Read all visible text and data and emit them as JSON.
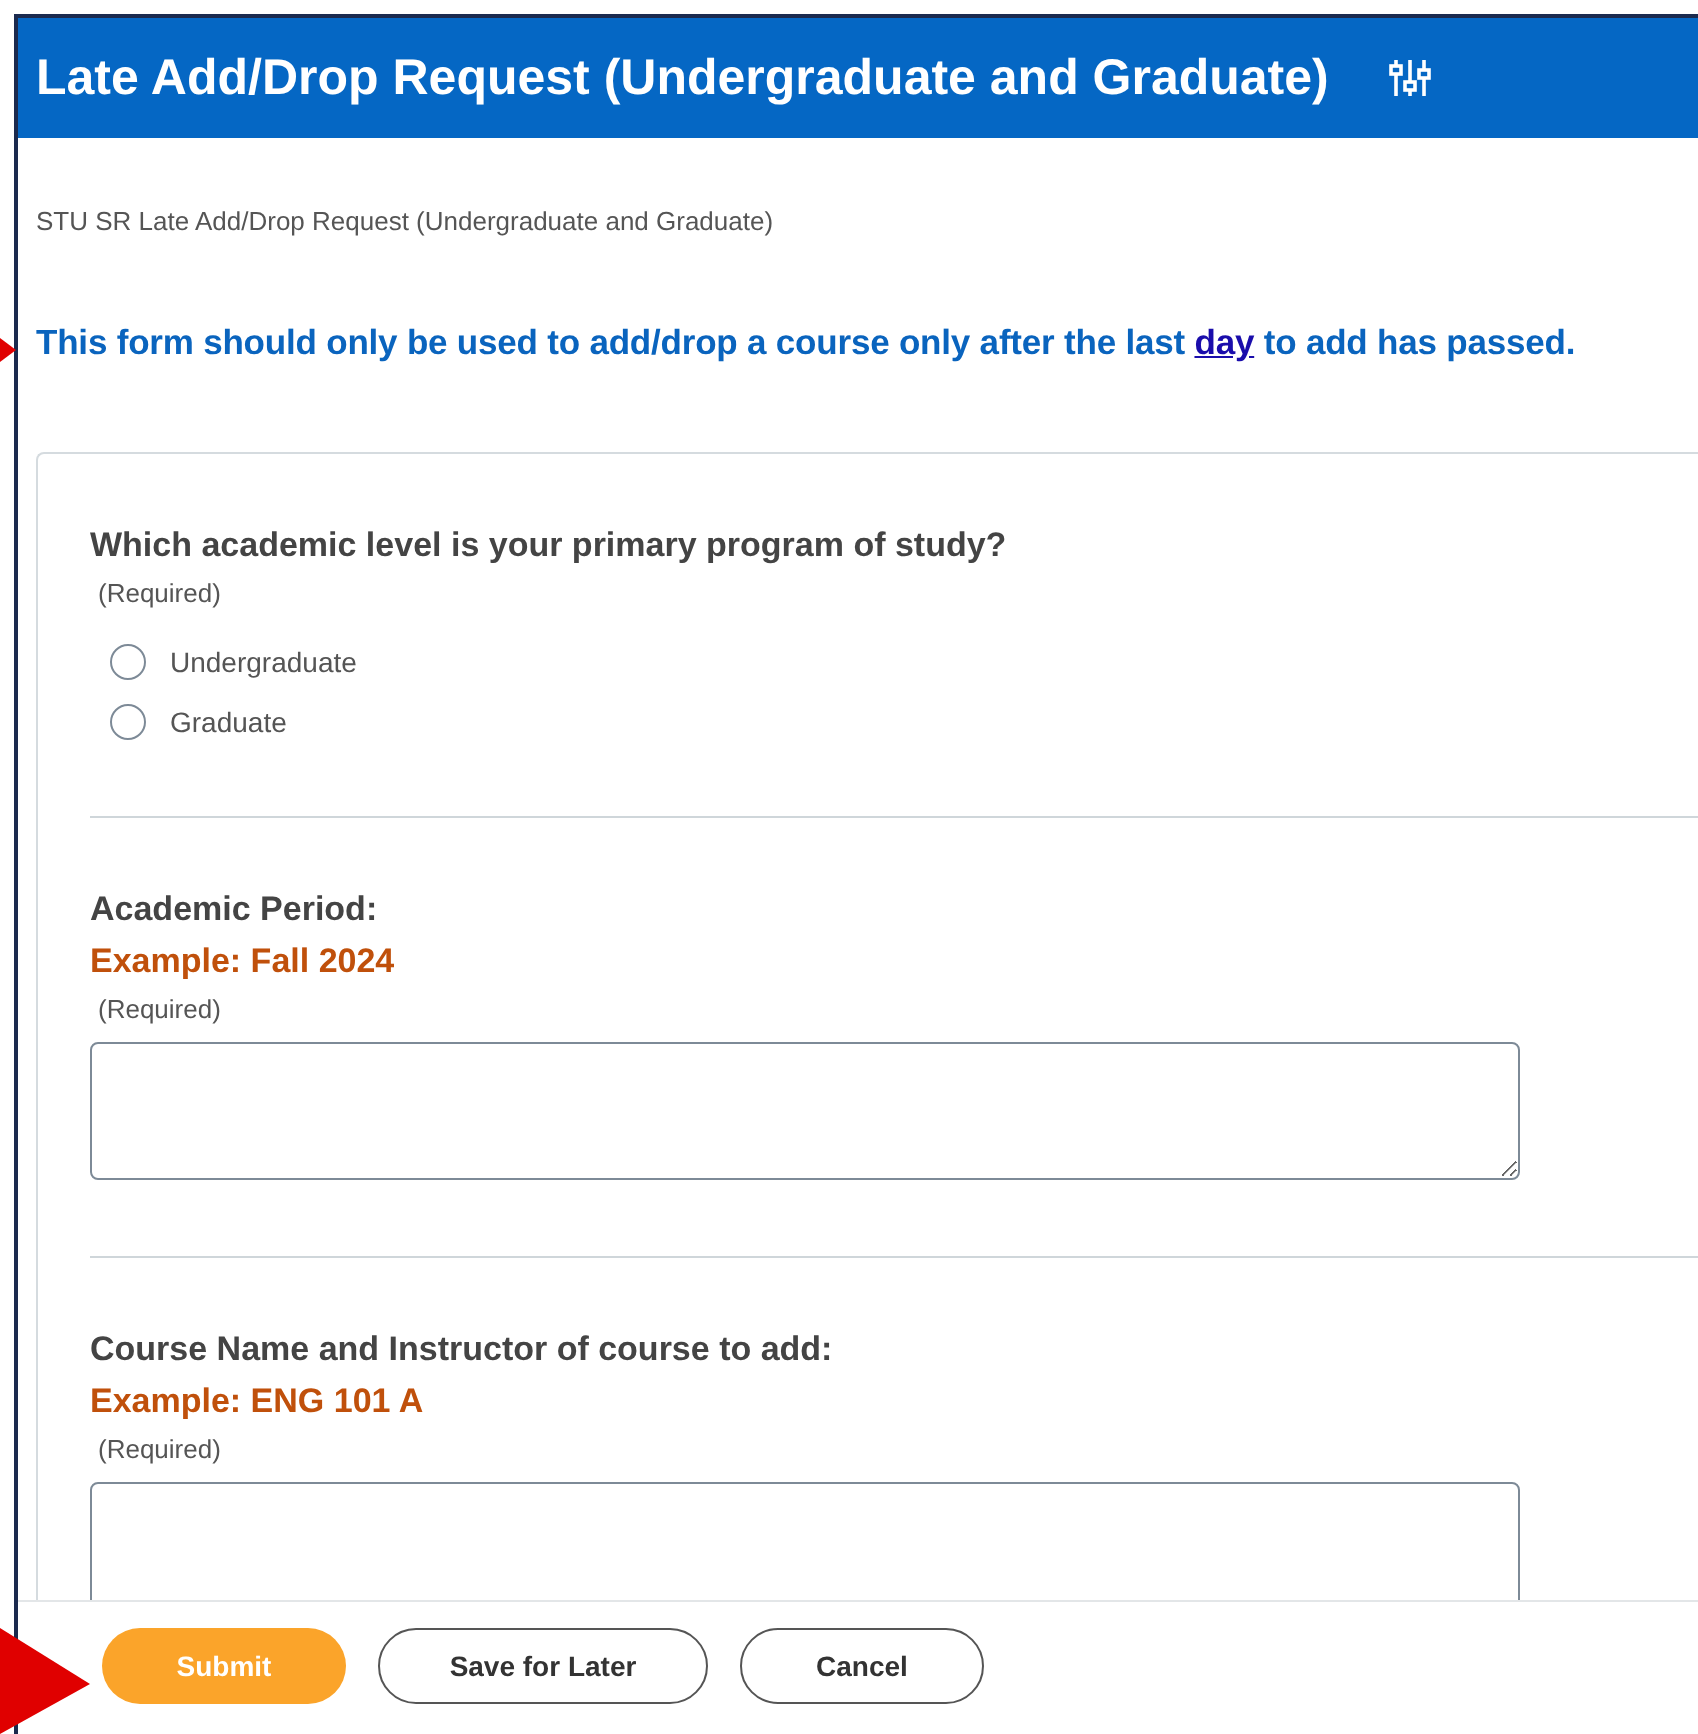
{
  "header": {
    "title": "Late Add/Drop Request (Undergraduate and Graduate)"
  },
  "subtitle": "STU SR Late Add/Drop Request (Undergraduate and Graduate)",
  "notice": {
    "before": "This form should only be used to add/drop a course only after the last",
    "link": "day",
    "after": "to add has passed.",
    "pointer_arrow": true
  },
  "questions": [
    {
      "kind": "radio",
      "label": "Which academic level is your primary program of study?",
      "required": "(Required)",
      "options": [
        {
          "label": "Undergraduate",
          "selected": false
        },
        {
          "label": "Graduate",
          "selected": false
        }
      ]
    },
    {
      "kind": "text",
      "label": "Academic Period:",
      "example": "Example: Fall 2024",
      "required": "(Required)"
    },
    {
      "kind": "text",
      "label": "Course Name and Instructor of course to add:",
      "example": "Example: ENG 101 A",
      "required": "(Required)"
    }
  ],
  "buttons": [
    {
      "label": "Submit",
      "kind": "primary",
      "pointer_arrow": true
    },
    {
      "label": "Save for Later",
      "kind": "secondary"
    },
    {
      "label": "Cancel",
      "kind": "secondary"
    }
  ]
}
